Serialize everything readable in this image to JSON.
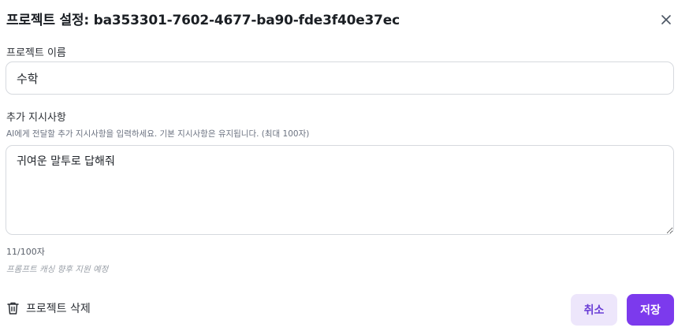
{
  "dialog": {
    "title": "프로젝트 설정: ba353301-7602-4677-ba90-fde3f40e37ec",
    "close_icon": "close-icon"
  },
  "project_name": {
    "label": "프로젝트 이름",
    "value": "수학"
  },
  "instructions": {
    "label": "추가 지시사항",
    "help_text": "AI에게 전달할 추가 지시사항을 입력하세요. 기본 지시사항은 유지됩니다. (최대 100자)",
    "value": "귀여운 말투로 답해줘",
    "char_count": "11/100자",
    "cache_note": "프롬프트 캐싱 향후 지원 예정"
  },
  "footer": {
    "delete_label": "프로젝트 삭제",
    "delete_icon": "trash-icon",
    "cancel_label": "취소",
    "save_label": "저장"
  },
  "colors": {
    "accent": "#7c3aed",
    "accent_soft": "#ede6fb",
    "border": "#d6d9de"
  }
}
